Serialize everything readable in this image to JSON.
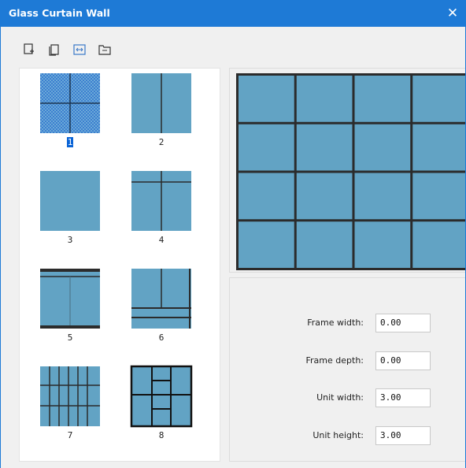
{
  "window": {
    "title": "Glass Curtain Wall",
    "close_symbol": "✕"
  },
  "toolbar": {
    "buttons": [
      {
        "icon": "add-unit-icon"
      },
      {
        "icon": "copy-icon"
      },
      {
        "icon": "fit-icon"
      },
      {
        "icon": "folder-icon"
      }
    ]
  },
  "gallery": {
    "items": [
      {
        "label": "1",
        "selected": true
      },
      {
        "label": "2",
        "selected": false
      },
      {
        "label": "3",
        "selected": false
      },
      {
        "label": "4",
        "selected": false
      },
      {
        "label": "5",
        "selected": false
      },
      {
        "label": "6",
        "selected": false
      },
      {
        "label": "7",
        "selected": false
      },
      {
        "label": "8",
        "selected": false
      }
    ]
  },
  "preview": {
    "columns": 4,
    "rows": 4,
    "glass_color": "#62a3c4",
    "frame_color": "#2b2b2b"
  },
  "properties": {
    "frame_width_label": "Frame width:",
    "frame_width_value": "0.00",
    "frame_depth_label": "Frame depth:",
    "frame_depth_value": "0.00",
    "unit_width_label": "Unit width:",
    "unit_width_value": "3.00",
    "unit_height_label": "Unit height:",
    "unit_height_value": "3.00"
  },
  "colors": {
    "accent": "#1e7ad6",
    "selection": "#0a64d6",
    "glass": "#62a3c4"
  }
}
